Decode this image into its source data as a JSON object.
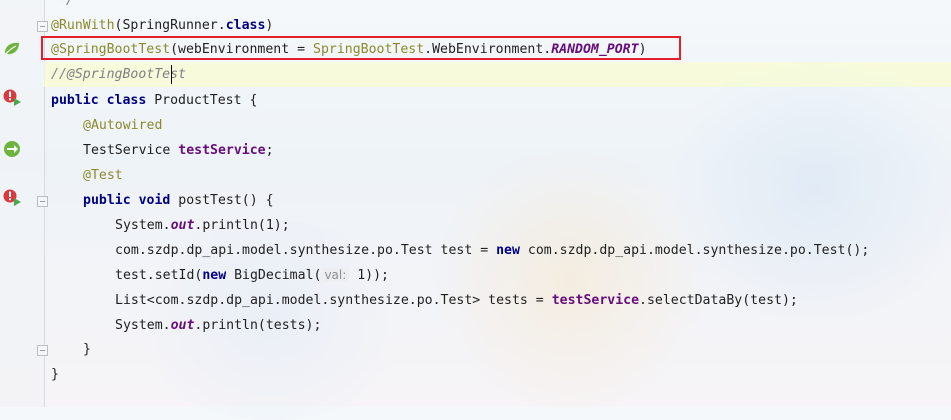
{
  "editor": {
    "lines": [
      {
        "tokens": [
          {
            "t": "*/",
            "c": "comment"
          }
        ]
      },
      {
        "tokens": [
          {
            "t": "@RunWith",
            "c": "ann"
          },
          {
            "t": "(SpringRunner.",
            "c": ""
          },
          {
            "t": "class",
            "c": "kw"
          },
          {
            "t": ")",
            "c": ""
          }
        ]
      },
      {
        "tokens": [
          {
            "t": "@SpringBootTest",
            "c": "ann"
          },
          {
            "t": "(webEnvironment = ",
            "c": ""
          },
          {
            "t": "SpringBootTest",
            "c": "ann"
          },
          {
            "t": ".WebEnvironment.",
            "c": ""
          },
          {
            "t": "RANDOM_PORT",
            "c": "static"
          },
          {
            "t": ")",
            "c": ""
          }
        ]
      },
      {
        "tokens": [
          {
            "t": "//@SpringBootTest",
            "c": "comment"
          }
        ]
      },
      {
        "tokens": [
          {
            "t": "public ",
            "c": "kw"
          },
          {
            "t": "class ",
            "c": "kw"
          },
          {
            "t": "ProductTest {",
            "c": ""
          }
        ]
      },
      {
        "tokens": [
          {
            "t": "@Autowired",
            "c": "ann"
          }
        ]
      },
      {
        "tokens": [
          {
            "t": "TestService ",
            "c": ""
          },
          {
            "t": "testService",
            "c": "field"
          },
          {
            "t": ";",
            "c": ""
          }
        ]
      },
      {
        "tokens": [
          {
            "t": "@Test",
            "c": "ann"
          }
        ]
      },
      {
        "tokens": [
          {
            "t": "public ",
            "c": "kw"
          },
          {
            "t": "void ",
            "c": "kw"
          },
          {
            "t": "postTest() {",
            "c": ""
          }
        ]
      },
      {
        "tokens": [
          {
            "t": "System.",
            "c": ""
          },
          {
            "t": "out",
            "c": "static"
          },
          {
            "t": ".println(1);",
            "c": ""
          }
        ]
      },
      {
        "tokens": [
          {
            "t": "com.szdp.dp_api.model.synthesize.po.Test test = ",
            "c": ""
          },
          {
            "t": "new ",
            "c": "kw"
          },
          {
            "t": "com.szdp.dp_api.model.synthesize.po.Test();",
            "c": ""
          }
        ]
      },
      {
        "tokens": [
          {
            "t": "test.setId(",
            "c": ""
          },
          {
            "t": "new ",
            "c": "kw"
          },
          {
            "t": "BigDecimal(",
            "c": ""
          },
          {
            "t": "val:",
            "c": "hint"
          },
          {
            "t": " 1));",
            "c": ""
          }
        ]
      },
      {
        "tokens": [
          {
            "t": "List<com.szdp.dp_api.model.synthesize.po.Test> tests = ",
            "c": ""
          },
          {
            "t": "testService",
            "c": "field"
          },
          {
            "t": ".selectDataBy(test);",
            "c": ""
          }
        ]
      },
      {
        "tokens": [
          {
            "t": "System.",
            "c": ""
          },
          {
            "t": "out",
            "c": "static"
          },
          {
            "t": ".println(tests);",
            "c": ""
          }
        ]
      },
      {
        "tokens": [
          {
            "t": "}",
            "c": ""
          }
        ]
      },
      {
        "tokens": [
          {
            "t": "}",
            "c": ""
          }
        ]
      }
    ]
  },
  "gutter": {
    "icons": [
      "spring-bean-icon",
      "run-test-class-icon",
      "spring-autowired-icon",
      "run-test-method-icon"
    ]
  },
  "colors": {
    "highlight_box": "#e3202a",
    "annotation": "#8a8a2c",
    "keyword": "#000080",
    "field": "#660e7a"
  }
}
